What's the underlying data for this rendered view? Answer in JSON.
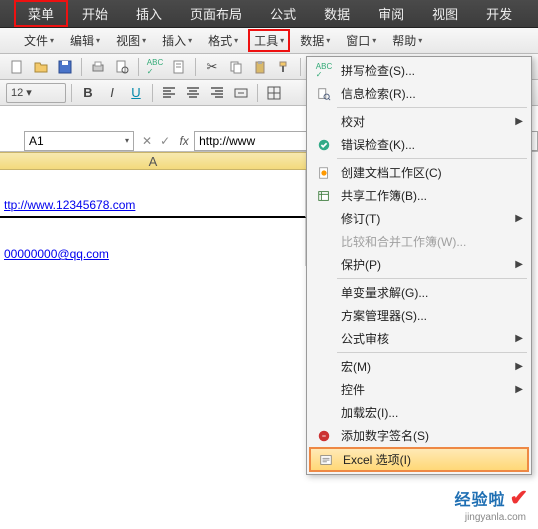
{
  "ribbon": {
    "tabs": [
      "菜单",
      "开始",
      "插入",
      "页面布局",
      "公式",
      "数据",
      "审阅",
      "视图",
      "开发"
    ],
    "active": "菜单"
  },
  "menubar": {
    "items": [
      "文件",
      "编辑",
      "视图",
      "插入",
      "格式",
      "工具",
      "数据",
      "窗口",
      "帮助"
    ],
    "active": "工具"
  },
  "name_box": "A1",
  "formula_value": "http://www",
  "column_header": "A",
  "cells": {
    "link1": "ttp://www.12345678.com",
    "link2": "00000000@qq.com"
  },
  "menu": {
    "items": [
      {
        "label": "拼写检查(S)...",
        "icon": "abc"
      },
      {
        "label": "信息检索(R)...",
        "icon": "search"
      },
      {
        "sep": true
      },
      {
        "label": "校对",
        "sub": true
      },
      {
        "label": "错误检查(K)...",
        "icon": "check"
      },
      {
        "sep": true
      },
      {
        "label": "创建文档工作区(C)",
        "icon": "doc"
      },
      {
        "label": "共享工作簿(B)...",
        "icon": "share"
      },
      {
        "label": "修订(T)",
        "sub": true
      },
      {
        "label": "比较和合并工作簿(W)...",
        "disabled": true
      },
      {
        "label": "保护(P)",
        "sub": true
      },
      {
        "sep": true
      },
      {
        "label": "单变量求解(G)..."
      },
      {
        "label": "方案管理器(S)..."
      },
      {
        "label": "公式审核",
        "sub": true
      },
      {
        "sep": true
      },
      {
        "label": "宏(M)",
        "sub": true
      },
      {
        "label": "控件",
        "sub": true
      },
      {
        "label": "加载宏(I)..."
      },
      {
        "label": "添加数字签名(S)",
        "icon": "sign"
      },
      {
        "label": "Excel 选项(I)",
        "icon": "gear",
        "highlight": true
      }
    ]
  },
  "watermark": {
    "text": "经验啦",
    "sub": "jingyanla.com"
  }
}
